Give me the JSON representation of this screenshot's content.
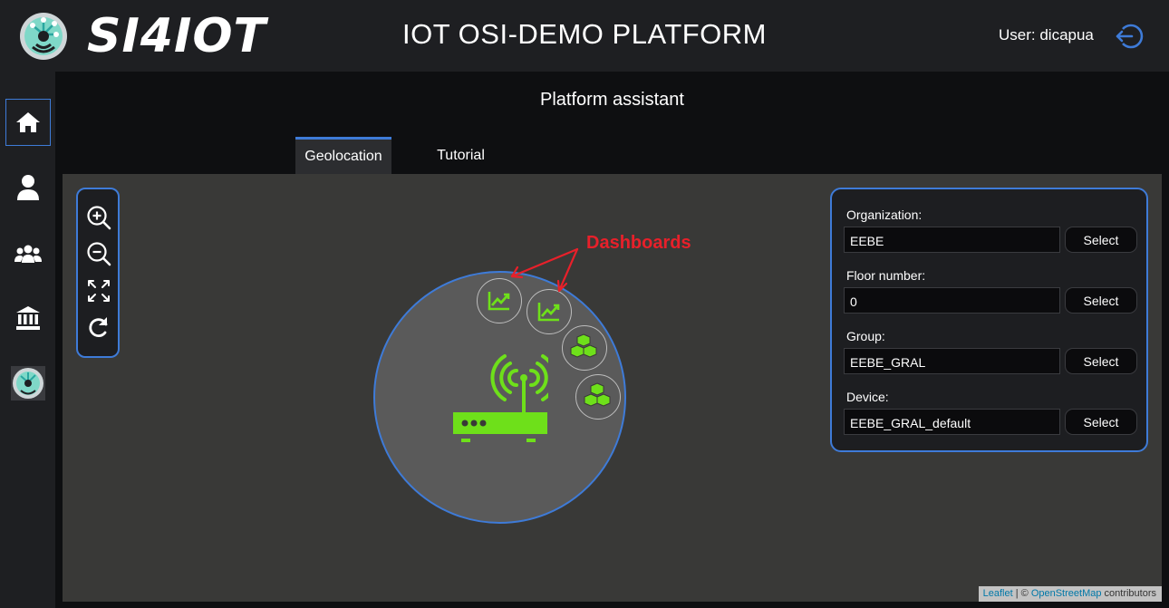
{
  "header": {
    "logo_text": "SI4IOT",
    "title": "IOT OSI-DEMO PLATFORM",
    "user_label": "User: dicapua"
  },
  "sidebar": {
    "items": [
      {
        "name": "home",
        "icon": "home-icon",
        "active": true
      },
      {
        "name": "user",
        "icon": "user-icon"
      },
      {
        "name": "groups",
        "icon": "users-icon"
      },
      {
        "name": "organization",
        "icon": "building-columns-icon"
      },
      {
        "name": "platform-logo",
        "icon": "si4iot-logo-icon"
      }
    ]
  },
  "main": {
    "section_title": "Platform assistant",
    "tabs": [
      {
        "label": "Geolocation",
        "active": true
      },
      {
        "label": "Tutorial"
      }
    ]
  },
  "map": {
    "controls": [
      "zoom-in-icon",
      "zoom-out-icon",
      "fit-bounds-icon",
      "refresh-icon"
    ],
    "annotation": "Dashboards",
    "annotation_color": "#e8202a",
    "nodes": [
      {
        "type": "dashboard",
        "icon": "chart-line-icon"
      },
      {
        "type": "dashboard",
        "icon": "chart-line-icon"
      },
      {
        "type": "group",
        "icon": "cubes-icon"
      },
      {
        "type": "group",
        "icon": "cubes-icon"
      }
    ],
    "gateway_icon": "router-wifi-icon",
    "accent_green": "#6ee01a",
    "accent_blue": "#3e7bd8",
    "attribution": {
      "leaflet": "Leaflet",
      "separator": " | © ",
      "osm": "OpenStreetMap",
      "suffix": " contributors"
    }
  },
  "form": {
    "fields": [
      {
        "label": "Organization:",
        "value": "EEBE",
        "button": "Select"
      },
      {
        "label": "Floor number:",
        "value": "0",
        "button": "Select"
      },
      {
        "label": "Group:",
        "value": "EEBE_GRAL",
        "button": "Select"
      },
      {
        "label": "Device:",
        "value": "EEBE_GRAL_default",
        "button": "Select"
      }
    ]
  }
}
